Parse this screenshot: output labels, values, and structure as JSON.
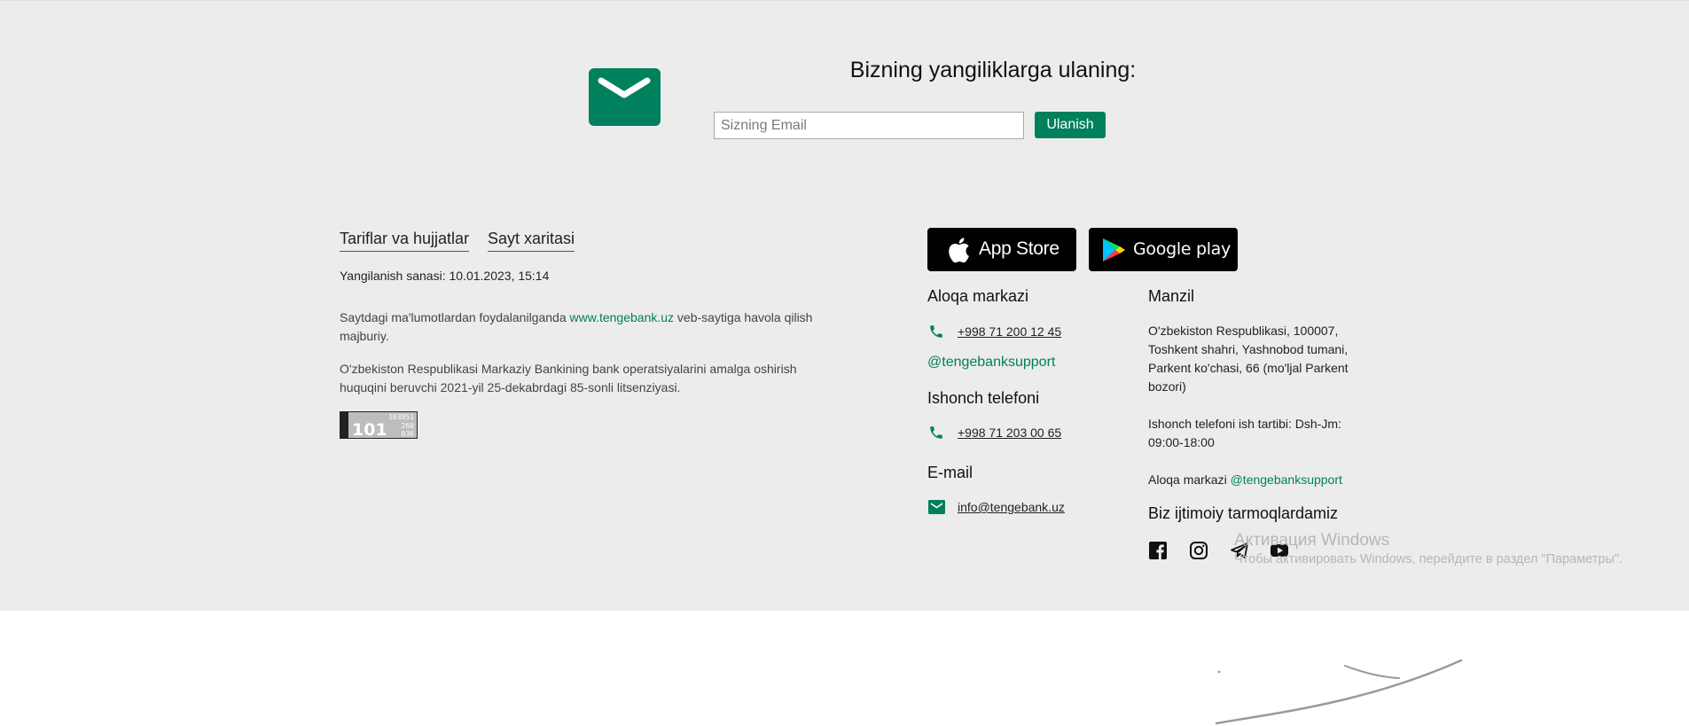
{
  "newsletter": {
    "title": "Bizning yangiliklarga ulaning:",
    "email_placeholder": "Sizning Email",
    "subscribe_label": "Ulanish"
  },
  "links": {
    "tariffs": "Tariflar va hujjatlar",
    "sitemap": "Sayt xaritasi"
  },
  "updated": "Yangilanish sanasi: 10.01.2023, 15:14",
  "info": {
    "usage_before": "Saytdagi ma'lumotlardan foydalanilganda ",
    "usage_link": "www.tengebank.uz",
    "usage_after": " veb-saytiga havola qilish majburiy.",
    "license": "O'zbekiston Respublikasi Markaziy Bankining bank operatsiyalarini amalga oshirish huquqini beruvchi 2021-yil 25-dekabrdagi 85-sonli litsenziyasi."
  },
  "counter": {
    "big": "101",
    "top": "103951",
    "mid": "260",
    "bot": "036"
  },
  "stores": {
    "appstore": "App Store",
    "googleplay": "Google play"
  },
  "contacts": {
    "call_center_title": "Aloqa markazi",
    "call_center_phone": "+998 71 200 12 45",
    "support_handle": "@tengebanksupport",
    "trust_title": "Ishonch telefoni",
    "trust_phone": "+998 71 203 00 65",
    "email_title": "E-mail",
    "email": "info@tengebank.uz"
  },
  "address": {
    "title": "Manzil",
    "text": "O'zbekiston Respublikasi, 100007, Toshkent shahri, Yashnobod tumani, Parkent ko'chasi, 66 (mo'ljal Parkent bozori)",
    "hours": "Ishonch telefoni ish tartibi: Dsh-Jm: 09:00-18:00",
    "call_center_label": "Aloqa markazi ",
    "call_center_handle": "@tengebanksupport"
  },
  "social": {
    "title": "Biz ijtimoiy tarmoqlardamiz",
    "icons": [
      "facebook-icon",
      "instagram-icon",
      "telegram-icon",
      "youtube-icon"
    ]
  },
  "watermark": {
    "title": "Активация Windows",
    "subtitle": "Чтобы активировать Windows, перейдите в раздел \"Параметры\"."
  },
  "colors": {
    "accent": "#00805c",
    "footer_bg": "#ececec"
  }
}
